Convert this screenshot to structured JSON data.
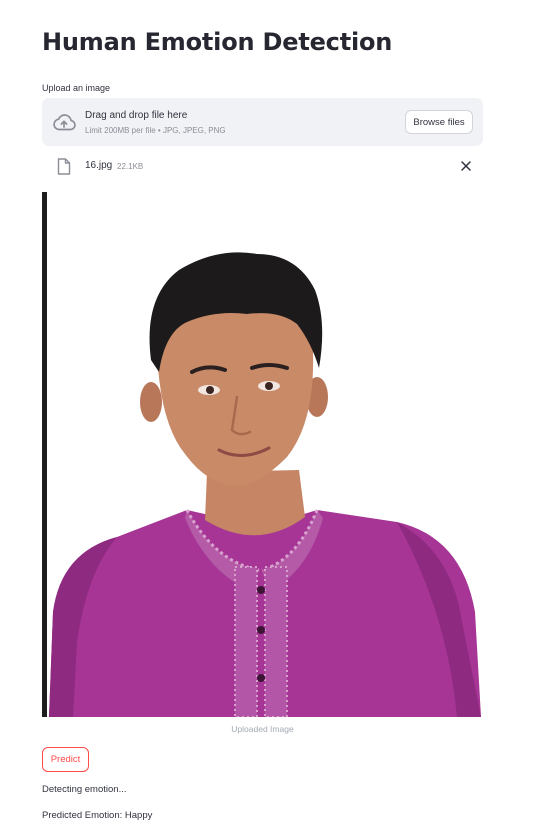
{
  "app": {
    "title": "Human Emotion Detection"
  },
  "uploader": {
    "label": "Upload an image",
    "drop_title": "Drag and drop file here",
    "drop_hint": "Limit 200MB per file • JPG, JPEG, PNG",
    "browse_label": "Browse files",
    "icon": "cloud-upload-icon"
  },
  "file": {
    "name": "16.jpg",
    "size": "22.1KB",
    "icon": "file-icon"
  },
  "image": {
    "caption": "Uploaded Image"
  },
  "actions": {
    "predict_label": "Predict"
  },
  "output": {
    "status": "Detecting emotion...",
    "result": "Predicted Emotion: Happy"
  },
  "colors": {
    "accent": "#ff4b4b",
    "dropzone_bg": "#f0f2f6",
    "text": "#31333f",
    "muted": "#8b8e96"
  }
}
